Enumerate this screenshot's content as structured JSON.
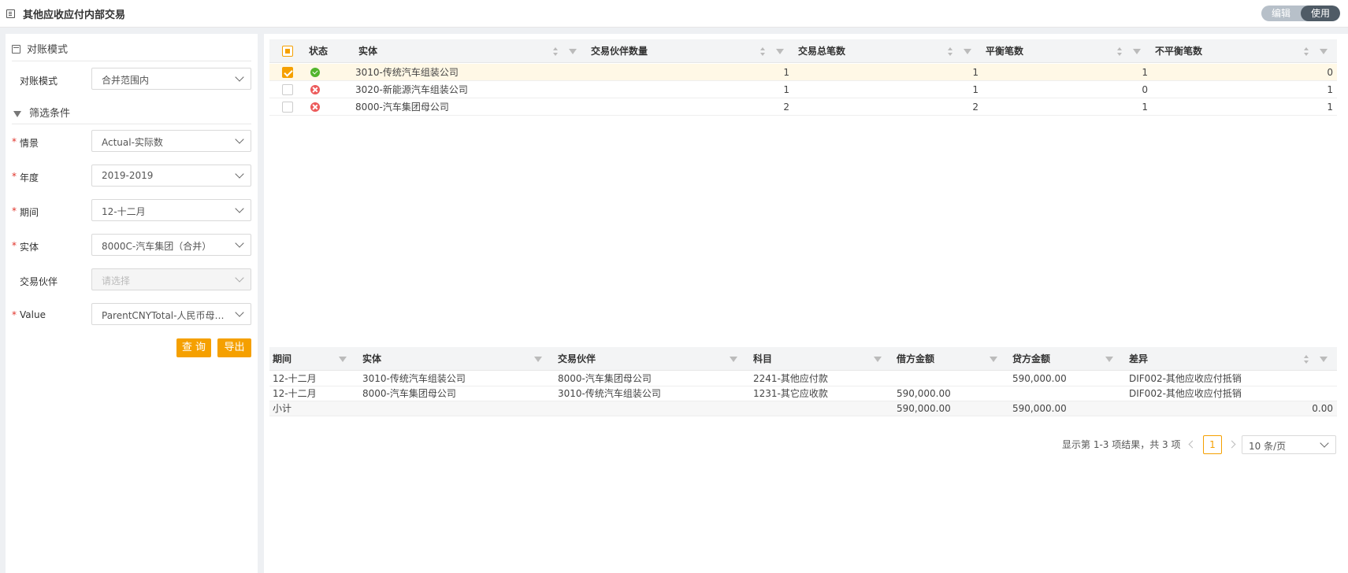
{
  "header": {
    "title": "其他应收应付内部交易",
    "mode_options": [
      "编辑",
      "使用"
    ],
    "mode_active": "使用"
  },
  "left": {
    "recon_section": "对账模式",
    "recon_mode": {
      "label": "对账模式",
      "value": "合并范围内"
    },
    "filter_section": "筛选条件",
    "filters": [
      {
        "label": "情景",
        "value": "Actual-实际数",
        "required": true
      },
      {
        "label": "年度",
        "value": "2019-2019",
        "required": true
      },
      {
        "label": "期间",
        "value": "12-十二月",
        "required": true
      },
      {
        "label": "实体",
        "value": "8000C-汽车集团（合并）",
        "required": true
      },
      {
        "label": "交易伙伴",
        "value": "请选择",
        "required": false,
        "placeholder": true
      },
      {
        "label": "Value",
        "value": "ParentCNYTotal-人民币母公...",
        "required": true
      }
    ],
    "query_btn": "查 询",
    "export_btn": "导出"
  },
  "summary_table": {
    "columns": [
      "状态",
      "实体",
      "交易伙伴数量",
      "交易总笔数",
      "平衡笔数",
      "不平衡笔数"
    ],
    "rows": [
      {
        "checked": true,
        "status": "ok",
        "entity": "3010-传统汽车组装公司",
        "partners": "1",
        "total": "1",
        "balanced": "1",
        "unbalanced": "0"
      },
      {
        "checked": false,
        "status": "error",
        "entity": "3020-新能源汽车组装公司",
        "partners": "1",
        "total": "1",
        "balanced": "0",
        "unbalanced": "1"
      },
      {
        "checked": false,
        "status": "error",
        "entity": "8000-汽车集团母公司",
        "partners": "2",
        "total": "2",
        "balanced": "1",
        "unbalanced": "1"
      }
    ]
  },
  "detail_table": {
    "columns": [
      "期间",
      "实体",
      "交易伙伴",
      "科目",
      "借方金额",
      "贷方金额",
      "差异"
    ],
    "rows": [
      {
        "period": "12-十二月",
        "entity": "3010-传统汽车组装公司",
        "partner": "8000-汽车集团母公司",
        "account": "2241-其他应付款",
        "debit": "",
        "credit": "590,000.00",
        "diff": "DIF002-其他应收应付抵销"
      },
      {
        "period": "12-十二月",
        "entity": "8000-汽车集团母公司",
        "partner": "3010-传统汽车组装公司",
        "account": "1231-其它应收款",
        "debit": "590,000.00",
        "credit": "",
        "diff": "DIF002-其他应收应付抵销"
      }
    ],
    "subtotal": {
      "label": "小计",
      "debit": "590,000.00",
      "credit": "590,000.00",
      "diff": "0.00"
    }
  },
  "pagination": {
    "summary": "显示第 1-3 项结果，共 3 项",
    "current_page": "1",
    "page_size": "10 条/页"
  },
  "colors": {
    "accent": "#f5a000",
    "ok": "#52b52d",
    "error": "#ec5a5a"
  }
}
